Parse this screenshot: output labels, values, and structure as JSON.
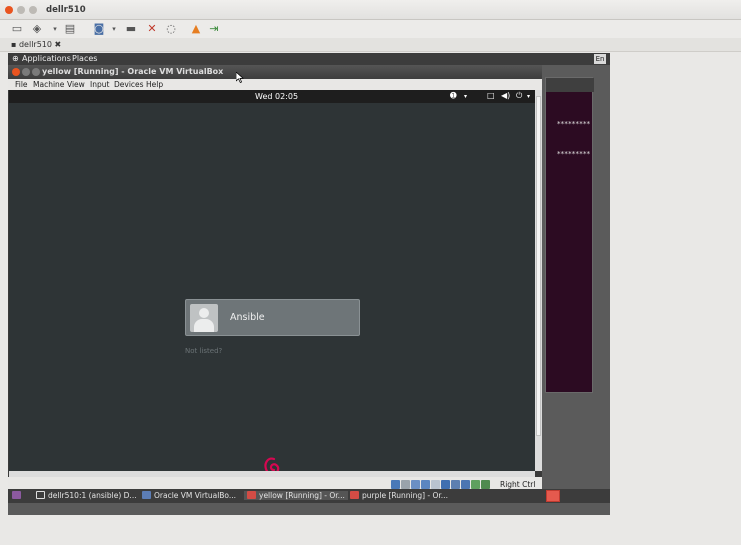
{
  "outer_window": {
    "title": "dellr510"
  },
  "outer_tab": {
    "label": "dellr510"
  },
  "gnome_panel": {
    "applications": "Applications",
    "places": "Places",
    "lang": "En"
  },
  "purple_window": {
    "line1": "*********",
    "line2": "*********"
  },
  "vbox_window": {
    "title": "yellow [Running] - Oracle VM VirtualBox",
    "menu": [
      "File",
      "Machine",
      "View",
      "Input",
      "Devices",
      "Help"
    ],
    "host_key": "Right Ctrl"
  },
  "guest": {
    "clock": "Wed 02:05",
    "user_name": "Ansible",
    "not_listed": "Not listed?"
  },
  "taskbar": {
    "items": [
      "dellr510:1 (ansible) D...",
      "Oracle VM VirtualBo...",
      "yellow [Running] - Or...",
      "purple [Running] - Or..."
    ]
  },
  "colors": {
    "guest_bg": "#2e3436",
    "debian_red": "#d70751",
    "purple_bg": "#2c0b22"
  }
}
